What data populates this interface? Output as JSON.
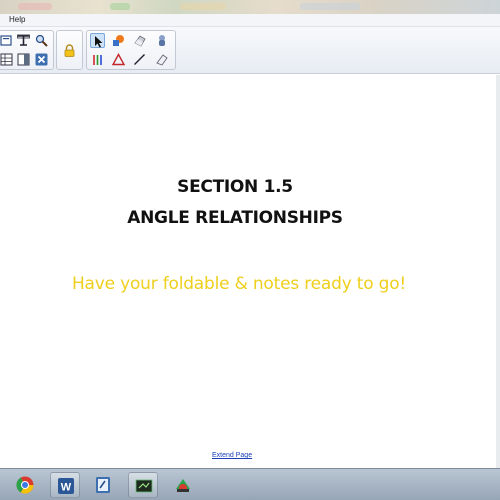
{
  "menubar": {
    "help_label": "Help"
  },
  "toolbar": {
    "left_tools": [
      "text-tool-icon",
      "table-icon",
      "magnifier-icon",
      "grid-icon",
      "columns-icon",
      "close-box-icon"
    ],
    "lock_tool": "lock-icon",
    "right_tools": [
      "select-arrow-icon",
      "shape-fill-icon",
      "eraser-icon",
      "hand-pen-icon",
      "color-pens-icon",
      "triangle-icon",
      "line-icon",
      "clear-eraser-icon"
    ],
    "accent": "#7aa7d8"
  },
  "page": {
    "heading_line1": "SECTION 1.5",
    "heading_line2": "ANGLE RELATIONSHIPS",
    "note": "Have your foldable & notes ready to go!",
    "note_color": "#eecf1c",
    "extend_page_link": "Extend Page"
  },
  "taskbar": {
    "apps": [
      "chrome-icon",
      "word-icon",
      "notes-icon",
      "whiteboard-icon",
      "notebook-icon"
    ]
  }
}
